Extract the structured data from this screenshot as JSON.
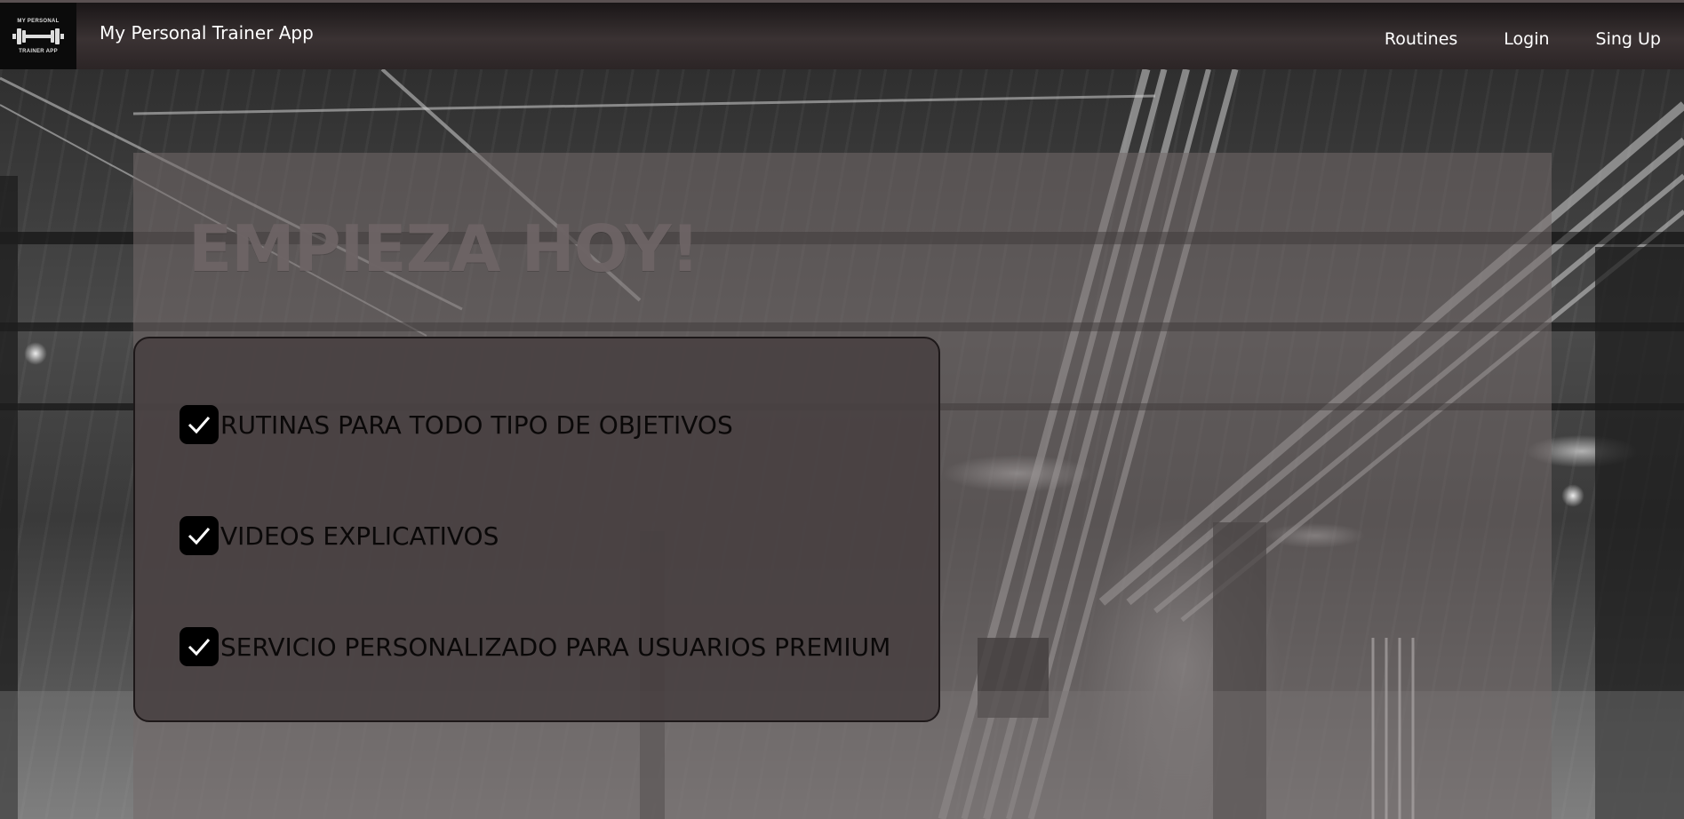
{
  "navbar": {
    "logo_line1": "MY PERSONAL",
    "logo_line2": "TRAINER APP",
    "brand": "My Personal Trainer App",
    "links": [
      "Routines",
      "Login",
      "Sing Up"
    ]
  },
  "hero": {
    "title": "EMPIEZA HOY!",
    "features": [
      "RUTINAS PARA TODO TIPO DE OBJETIVOS",
      "VIDEOS EXPLICATIVOS",
      "SERVICIO PERSONALIZADO PARA USUARIOS PREMIUM"
    ]
  },
  "colors": {
    "navbar": "#2c2526",
    "panel_overlay": "#73696a",
    "feature_box": "#484041",
    "check_bg": "#000000"
  }
}
